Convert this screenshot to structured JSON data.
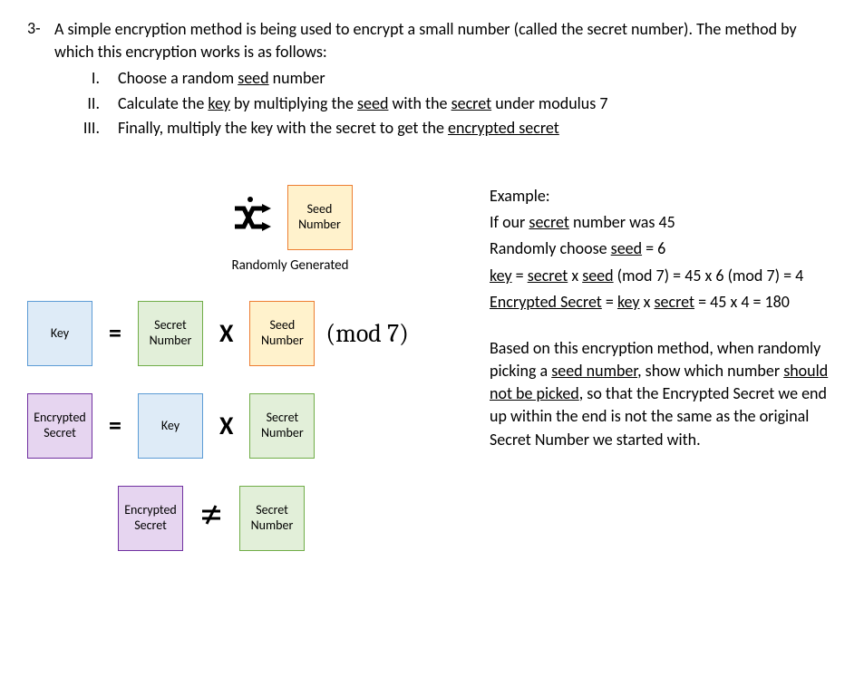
{
  "question": {
    "number": "3-",
    "intro": "A simple encryption method is being used to encrypt a small number (called the secret number). The method by which this encryption works is as follows:",
    "steps": [
      {
        "num": "I.",
        "before": "Choose a random ",
        "u1": "seed",
        "after": " number"
      },
      {
        "num": "II.",
        "parts": [
          "Calculate the ",
          "key",
          " by multiplying the ",
          "seed",
          " with the ",
          "secret",
          " under modulus 7"
        ]
      },
      {
        "num": "III.",
        "parts": [
          "Finally, multiply the key with the secret to get the ",
          "encrypted secret"
        ]
      }
    ]
  },
  "diagram": {
    "random_label": "Randomly Generated",
    "seed_box": "Seed Number",
    "key_box": "Key",
    "secret_box": "Secret Number",
    "encrypted_box": "Encrypted Secret",
    "eq": "=",
    "times": "X",
    "mod": "(mod 7)",
    "neq": "≠"
  },
  "example": {
    "title": "Example:",
    "l1a": "If our ",
    "l1u": "secret",
    "l1b": " number was 45",
    "l2a": "Randomly choose ",
    "l2u": "seed",
    "l2b": " = 6",
    "l3a": "key",
    "l3b": " = ",
    "l3c": "secret",
    "l3d": " x ",
    "l3e": "seed",
    "l3f": " (mod 7) =  45 x 6 (mod 7)  =   4",
    "l4a": "Encrypted Secret",
    "l4b": " = ",
    "l4c": "key",
    "l4d": " x ",
    "l4e": "secret",
    "l4f": " = 45 x 4 = 180"
  },
  "task": {
    "p1": "Based on this encryption method, when randomly picking a ",
    "u1": "seed number",
    "p2": ", show which number ",
    "u2": "should not be picked",
    "p3": ", so that the Encrypted Secret we end up within the end is not the same as the original Secret Number we started with."
  }
}
